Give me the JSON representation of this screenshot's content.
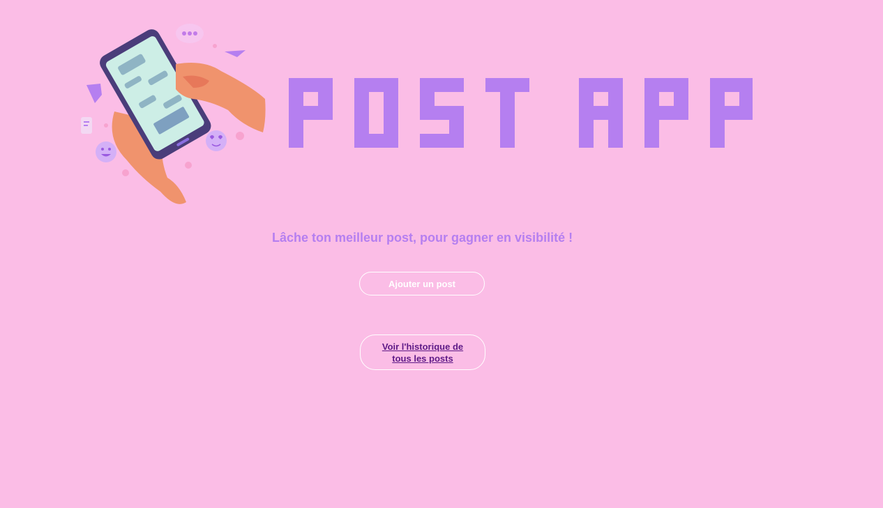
{
  "hero": {
    "illustration_icon": "hand-holding-phone-illustration",
    "logo_text": "POST APP"
  },
  "main": {
    "tagline": "Lâche ton meilleur post, pour gagner en visibilité !",
    "add_post_label": "Ajouter un post",
    "history_link_label": "Voir l'historique de tous les posts"
  },
  "colors": {
    "background": "#fbbde6",
    "accent": "#b57ff0",
    "link": "#5e1a87"
  }
}
